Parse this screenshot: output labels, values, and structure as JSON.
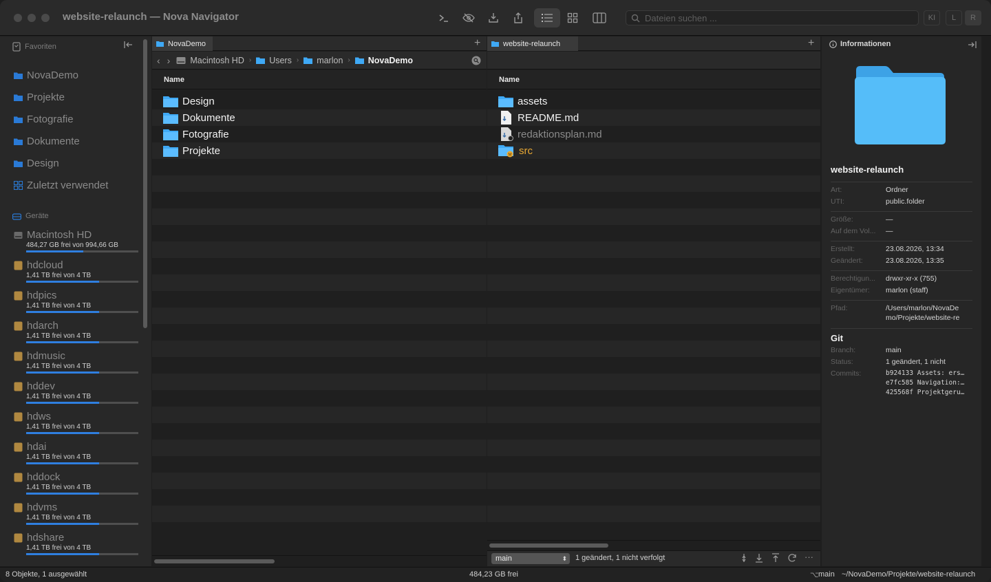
{
  "window": {
    "title": "website-relaunch — Nova Navigator"
  },
  "toolbar": {
    "search_placeholder": "Dateien suchen ...",
    "pills": [
      "KI",
      "L",
      "R"
    ]
  },
  "sidebar": {
    "favorites_header": "Favoriten",
    "favorites": [
      "NovaDemo",
      "Projekte",
      "Fotografie",
      "Dokumente",
      "Design",
      "Zuletzt verwendet"
    ],
    "devices_header": "Geräte",
    "devices": [
      {
        "name": "Macintosh HD",
        "info": "484,27 GB frei von 994,66 GB",
        "used": 0.51
      },
      {
        "name": "hdcloud",
        "info": "1,41 TB frei von 4 TB",
        "used": 0.65
      },
      {
        "name": "hdpics",
        "info": "1,41 TB frei von 4 TB",
        "used": 0.65
      },
      {
        "name": "hdarch",
        "info": "1,41 TB frei von 4 TB",
        "used": 0.65
      },
      {
        "name": "hdmusic",
        "info": "1,41 TB frei von 4 TB",
        "used": 0.65
      },
      {
        "name": "hddev",
        "info": "1,41 TB frei von 4 TB",
        "used": 0.65
      },
      {
        "name": "hdws",
        "info": "1,41 TB frei von 4 TB",
        "used": 0.65
      },
      {
        "name": "hdai",
        "info": "1,41 TB frei von 4 TB",
        "used": 0.65
      },
      {
        "name": "hddock",
        "info": "1,41 TB frei von 4 TB",
        "used": 0.65
      },
      {
        "name": "hdvms",
        "info": "1,41 TB frei von 4 TB",
        "used": 0.65
      },
      {
        "name": "hdshare",
        "info": "1,41 TB frei von 4 TB",
        "used": 0.65
      }
    ]
  },
  "left_pane": {
    "tab": "NovaDemo",
    "path": [
      "Macintosh HD",
      "Users",
      "marlon",
      "NovaDemo"
    ],
    "column": "Name",
    "items": [
      "Design",
      "Dokumente",
      "Fotografie",
      "Projekte"
    ]
  },
  "right_pane": {
    "tab": "website-relaunch",
    "column": "Name",
    "items": [
      {
        "name": "assets",
        "kind": "folder"
      },
      {
        "name": "README.md",
        "kind": "file"
      },
      {
        "name": "redaktionsplan.md",
        "kind": "file-untracked"
      },
      {
        "name": "src",
        "kind": "folder-modified"
      }
    ],
    "git_branch": "main",
    "git_status": "1 geändert, 1 nicht verfolgt"
  },
  "info": {
    "header": "Informationen",
    "name": "website-relaunch",
    "rows1": [
      {
        "k": "Art:",
        "v": "Ordner"
      },
      {
        "k": "UTI:",
        "v": "public.folder"
      }
    ],
    "rows2": [
      {
        "k": "Größe:",
        "v": "—"
      },
      {
        "k": "Auf dem Vol...",
        "v": "—"
      }
    ],
    "rows3": [
      {
        "k": "Erstellt:",
        "v": "23.08.2026, 13:34"
      },
      {
        "k": "Geändert:",
        "v": "23.08.2026, 13:35"
      }
    ],
    "rows4": [
      {
        "k": "Berechtigun...",
        "v": "drwxr-xr-x (755)"
      },
      {
        "k": "Eigentümer:",
        "v": "marlon (staff)"
      }
    ],
    "path_label": "Pfad:",
    "path_line1": "/Users/marlon/NovaDe",
    "path_line2": "mo/Projekte/website-re",
    "git_title": "Git",
    "branch_label": "Branch:",
    "branch": "main",
    "status_label": "Status:",
    "status": "1 geändert, 1 nicht",
    "commits_label": "Commits:",
    "commits": [
      "b924133 Assets: ers…",
      "e7fc585 Navigation:…",
      "425568f Projektgeru…"
    ]
  },
  "footer": {
    "left": "8 Objekte, 1 ausgewählt",
    "center": "484,23 GB frei",
    "branch": "main",
    "path": "~/NovaDemo/Projekte/website-relaunch"
  },
  "colors": {
    "folder": "#3fa9f5",
    "accent": "#2f7fe0",
    "modified": "#e8a833"
  }
}
